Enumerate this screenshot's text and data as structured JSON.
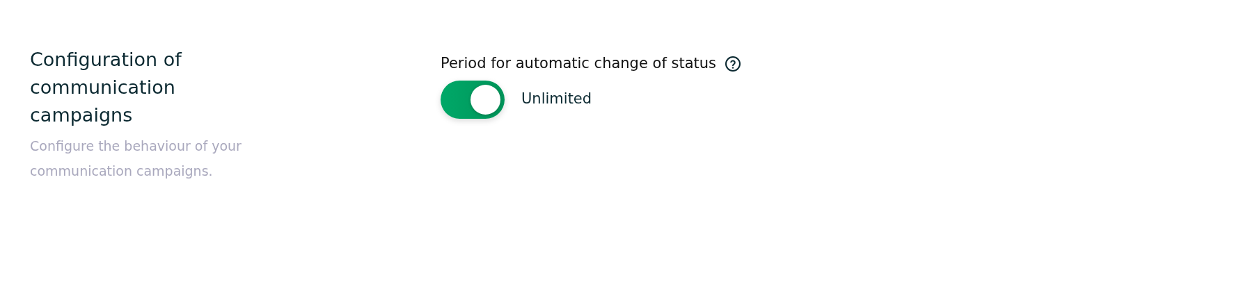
{
  "section": {
    "title": "Configuration of communication campaigns",
    "description": "Configure the behaviour of your communication campaigns."
  },
  "setting": {
    "label": "Period for automatic change of status",
    "toggle": {
      "on": true
    },
    "value_label": "Unlimited"
  }
}
